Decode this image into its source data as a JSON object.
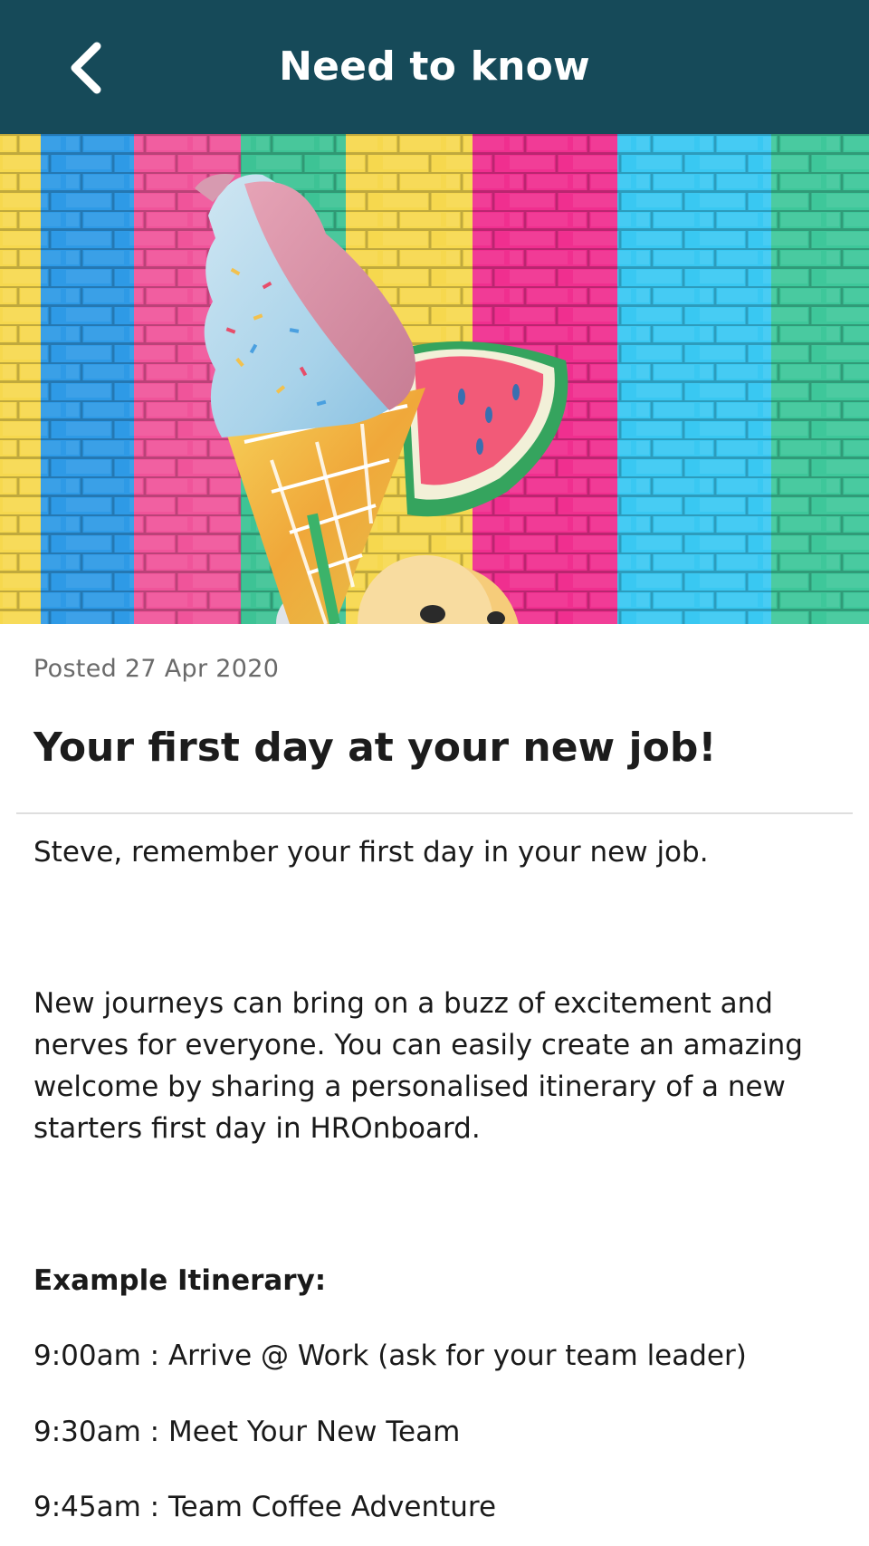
{
  "header": {
    "title": "Need to know",
    "back_icon": "chevron-left-icon",
    "background": "#164a59"
  },
  "hero": {
    "image": "colorful-brick-wall-with-ice-cream-watermelon-balloons"
  },
  "article": {
    "posted": "Posted 27 Apr 2020",
    "title": "Your first day at your new job!",
    "paragraphs": [
      "Steve, remember your first day in your new job.",
      "New journeys can bring on a buzz of excitement and nerves for everyone. You can easily create an amazing welcome by sharing a personalised itinerary of a new starters first day in HROnboard."
    ],
    "itinerary_heading": "Example Itinerary:",
    "itinerary": [
      "9:00am : Arrive @ Work (ask for your team leader)",
      "9:30am : Meet Your New Team",
      "9:45am : Team Coffee Adventure"
    ]
  }
}
